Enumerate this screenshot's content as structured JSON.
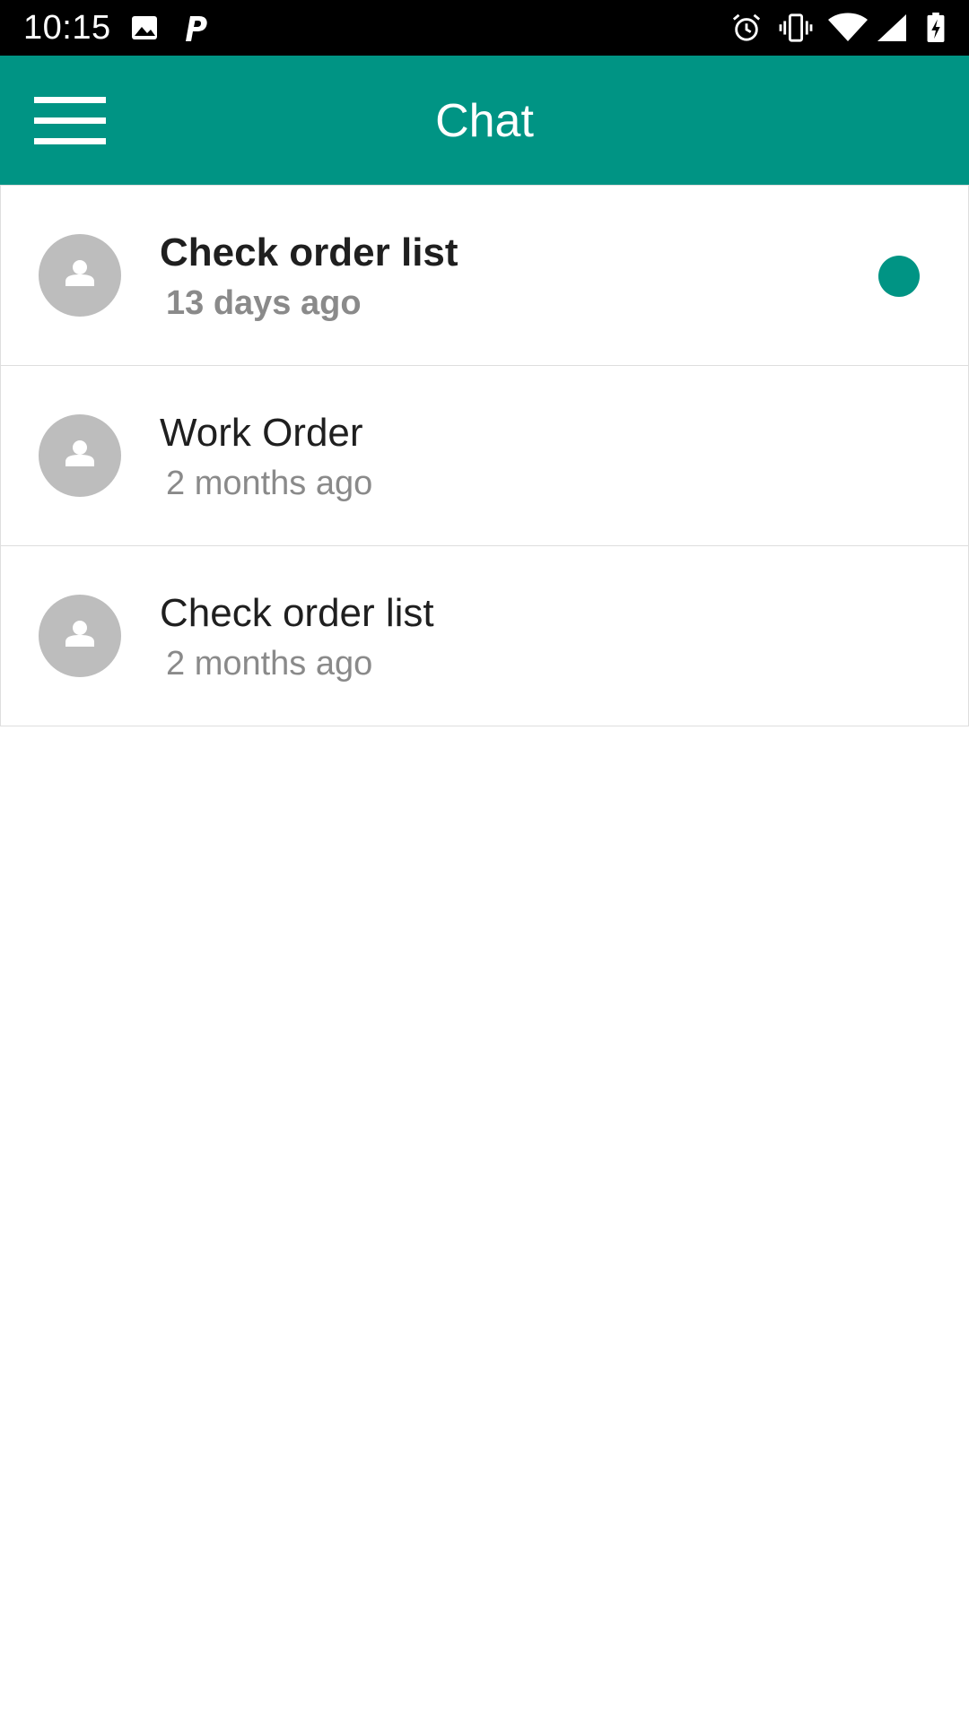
{
  "status_bar": {
    "time": "10:15",
    "icons": [
      "image-icon",
      "p-app-icon",
      "alarm-icon",
      "vibrate-icon",
      "wifi-icon",
      "signal-icon",
      "battery-charging-icon"
    ]
  },
  "app_bar": {
    "title": "Chat",
    "menu_icon": "hamburger-menu-icon",
    "background_color": "#009484"
  },
  "conversations": [
    {
      "title": "Check order list",
      "time": "13 days ago",
      "unread": true
    },
    {
      "title": "Work Order",
      "time": "2 months ago",
      "unread": false
    },
    {
      "title": "Check order list",
      "time": "2 months ago",
      "unread": false
    }
  ],
  "colors": {
    "accent": "#009484",
    "avatar": "#bdbdbd",
    "secondary_text": "#8a8a8a"
  }
}
